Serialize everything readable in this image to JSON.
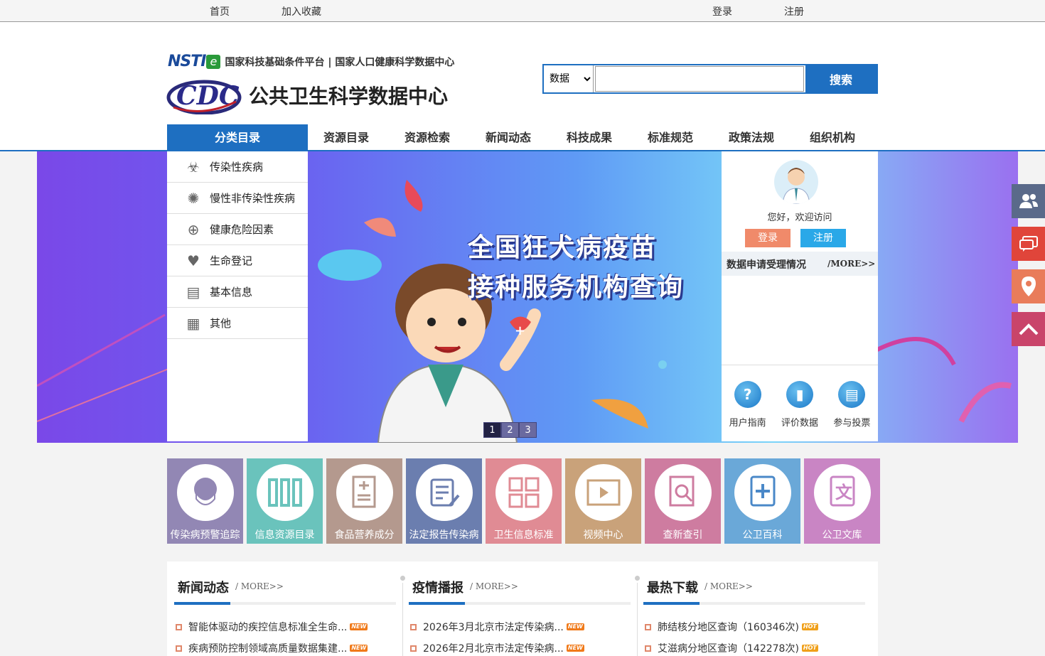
{
  "topbar": {
    "home": "首页",
    "favorite": "加入收藏",
    "login": "登录",
    "register": "注册"
  },
  "header": {
    "nsti_logo": "NSTI",
    "platform": "国家科技基础条件平台 | 国家人口健康科学数据中心",
    "site_title": "公共卫生科学数据中心",
    "cdc_logo": "CDC"
  },
  "search": {
    "select_value": "数据",
    "placeholder": "",
    "button": "搜索"
  },
  "nav": {
    "category": "分类目录",
    "items": [
      "资源目录",
      "资源检索",
      "新闻动态",
      "科技成果",
      "标准规范",
      "政策法规",
      "组织机构"
    ]
  },
  "sidebar": {
    "items": [
      {
        "label": "传染性疾病",
        "icon": "biohazard-icon"
      },
      {
        "label": "慢性非传染性疾病",
        "icon": "virus-icon"
      },
      {
        "label": "健康危险因素",
        "icon": "medkit-icon"
      },
      {
        "label": "生命登记",
        "icon": "heart-pulse-icon"
      },
      {
        "label": "基本信息",
        "icon": "document-icon"
      },
      {
        "label": "其他",
        "icon": "grid-icon"
      }
    ]
  },
  "banner": {
    "line1": "全国狂犬病疫苗",
    "line2": "接种服务机构查询",
    "pages": [
      "1",
      "2",
      "3"
    ],
    "active_page": 1
  },
  "user_panel": {
    "welcome": "您好，欢迎访问",
    "login": "登录",
    "register": "注册",
    "apply_title": "数据申请受理情况",
    "apply_more": "/MORE>>",
    "quick": [
      {
        "label": "用户指南",
        "icon": "question-icon",
        "glyph": "?"
      },
      {
        "label": "评价数据",
        "icon": "bar-chart-icon",
        "glyph": "▮"
      },
      {
        "label": "参与投票",
        "icon": "vote-icon",
        "glyph": "▤"
      }
    ]
  },
  "tiles": [
    {
      "label": "传染病预警追踪",
      "color": "#9287b4",
      "icon": "mask-icon"
    },
    {
      "label": "信息资源目录",
      "color": "#6ac3bc",
      "icon": "catalog-icon"
    },
    {
      "label": "食品营养成分",
      "color": "#b4998e",
      "icon": "nutrition-doc-icon"
    },
    {
      "label": "法定报告传染病",
      "color": "#6b7eaf",
      "icon": "report-icon"
    },
    {
      "label": "卫生信息标准",
      "color": "#e08b94",
      "icon": "standards-icon"
    },
    {
      "label": "视频中心",
      "color": "#c9a27a",
      "icon": "video-icon"
    },
    {
      "label": "查新查引",
      "color": "#ce7ca0",
      "icon": "search-doc-icon"
    },
    {
      "label": "公卫百科",
      "color": "#6aa8d8",
      "icon": "encyclopedia-icon"
    },
    {
      "label": "公卫文库",
      "color": "#c985c4",
      "icon": "library-icon"
    }
  ],
  "news": {
    "columns": [
      {
        "title": "新闻动态",
        "more": "/ MORE>>",
        "items": [
          {
            "text": "智能体驱动的疾控信息标准全生命...",
            "badge": "NEW"
          },
          {
            "text": "疾病预防控制领域高质量数据集建...",
            "badge": "NEW"
          }
        ]
      },
      {
        "title": "疫情播报",
        "more": "/ MORE>>",
        "items": [
          {
            "text": "2026年3月北京市法定传染病...",
            "badge": "NEW"
          },
          {
            "text": "2026年2月北京市法定传染病...",
            "badge": "NEW"
          }
        ]
      },
      {
        "title": "最热下载",
        "more": "/ MORE>>",
        "items": [
          {
            "text": "肺结核分地区查询（160346次)",
            "badge": "HOT"
          },
          {
            "text": "艾滋病分地区查询（142278次)",
            "badge": "HOT"
          }
        ]
      }
    ]
  },
  "rightbar": [
    {
      "icon": "users-icon",
      "color": "#5a6a8a"
    },
    {
      "icon": "chat-icon",
      "color": "#e0453a"
    },
    {
      "icon": "location-icon",
      "color": "#e97c5a"
    },
    {
      "icon": "back-to-top-icon",
      "color": "#c9446a"
    }
  ]
}
